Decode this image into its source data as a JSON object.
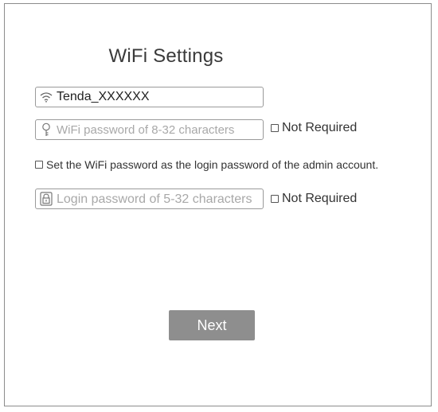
{
  "page": {
    "title": "WiFi Settings"
  },
  "ssid": {
    "value": "Tenda_XXXXXX",
    "icon": "wifi-icon"
  },
  "wifi_password": {
    "placeholder": "WiFi password of 8-32 characters",
    "icon": "key-icon",
    "not_required_label": "Not Required"
  },
  "use_wifi_as_login": {
    "label": "Set the WiFi password as the login password of the admin account."
  },
  "login_password": {
    "placeholder": "Login password of 5-32 characters",
    "icon": "lock-icon",
    "not_required_label": "Not Required"
  },
  "actions": {
    "next_label": "Next"
  },
  "colors": {
    "button_bg": "#8e8e8e",
    "border": "#9a9a9a",
    "placeholder": "#a8a8a8"
  }
}
